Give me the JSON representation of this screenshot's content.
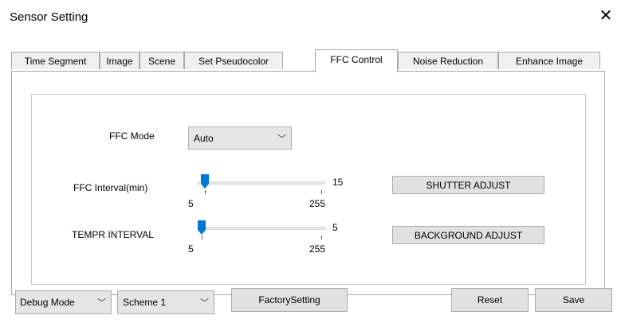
{
  "window": {
    "title": "Sensor Setting",
    "close_icon": "close-icon"
  },
  "tabs": [
    {
      "label": "Time Segment"
    },
    {
      "label": "Image"
    },
    {
      "label": "Scene"
    },
    {
      "label": "Set Pseudocolor"
    },
    {
      "label": "FFC Control",
      "active": true
    },
    {
      "label": "Noise Reduction"
    },
    {
      "label": "Enhance Image"
    }
  ],
  "ffc": {
    "mode_label": "FFC Mode",
    "mode_value": "Auto",
    "interval_label": "FFC Interval(min)",
    "interval_min": "5",
    "interval_max": "255",
    "interval_value": "15",
    "tempr_label": "TEMPR INTERVAL",
    "tempr_min": "5",
    "tempr_max": "255",
    "tempr_value": "5",
    "shutter_button": "SHUTTER ADJUST",
    "background_button": "BACKGROUND ADJUST"
  },
  "bottom": {
    "debug_mode": "Debug Mode",
    "scheme": "Scheme 1",
    "factory_button": "FactorySetting",
    "reset_button": "Reset",
    "save_button": "Save"
  },
  "colors": {
    "slider_thumb": "#0078d7",
    "button_bg": "#e1e1e1",
    "border": "#adadad"
  }
}
